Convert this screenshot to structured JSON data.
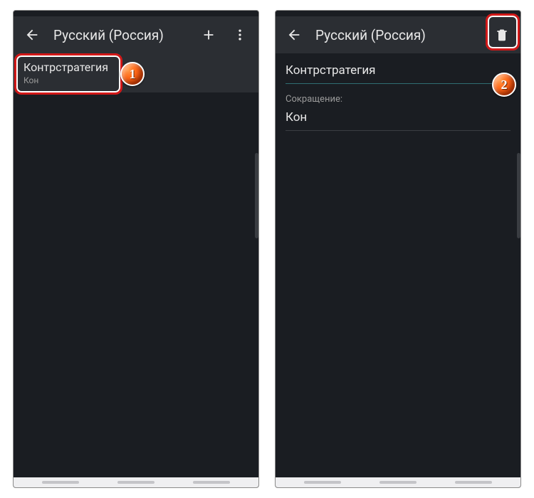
{
  "left": {
    "toolbar": {
      "title": "Русский (Россия)"
    },
    "row": {
      "primary": "Контрстратегия",
      "secondary": "Кон"
    },
    "badge": "1"
  },
  "right": {
    "toolbar": {
      "title": "Русский (Россия)"
    },
    "word_field": {
      "value": "Контрстратегия"
    },
    "short_field": {
      "label": "Сокращение:",
      "value": "Кон"
    },
    "badge": "2"
  }
}
